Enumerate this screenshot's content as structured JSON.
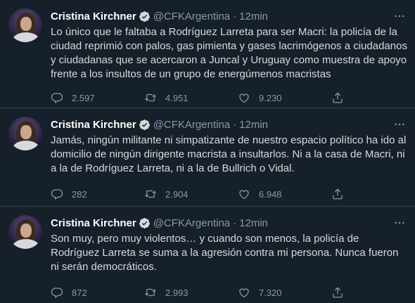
{
  "tweets": [
    {
      "author": "Cristina Kirchner",
      "handle": "@CFKArgentina",
      "separator": "·",
      "time": "12min",
      "text": "Lo único que le faltaba a Rodríguez Larreta para ser Macri: la policía de la ciudad reprimió con palos, gas pimienta y gases lacrimógenos a ciudadanos y ciudadanas que se acercaron a Juncal y Uruguay como muestra de apoyo frente a los insultos de un grupo de energúmenos macristas",
      "replies": "2.597",
      "retweets": "4.951",
      "likes": "9.230"
    },
    {
      "author": "Cristina Kirchner",
      "handle": "@CFKArgentina",
      "separator": "·",
      "time": "12min",
      "text": "Jamás, ningún militante ni simpatizante de nuestro espacio político ha ido al domicilio de ningún dirigente macrista a insultarlos. Ni a la casa de Macri, ni a la de Rodríguez Larreta, ni a la de Bullrich o Vidal.",
      "replies": "282",
      "retweets": "2.904",
      "likes": "6.948"
    },
    {
      "author": "Cristina Kirchner",
      "handle": "@CFKArgentina",
      "separator": "·",
      "time": "12min",
      "text": "Son muy, pero muy violentos… y cuando son menos, la policía de Rodríguez Larreta se suma a la agresión contra mi persona. Nunca fueron ni serán democráticos.",
      "replies": "872",
      "retweets": "2.993",
      "likes": "7.320"
    }
  ],
  "icons": {
    "verified": "verified-badge-icon",
    "more": "more-options-icon",
    "reply": "reply-icon",
    "retweet": "retweet-icon",
    "like": "like-icon",
    "share": "share-icon"
  },
  "colors": {
    "background": "#15202b",
    "text": "#d9d9d9",
    "muted": "#8b98a5",
    "divider": "#38444d",
    "verified": "#d9d9d9"
  }
}
